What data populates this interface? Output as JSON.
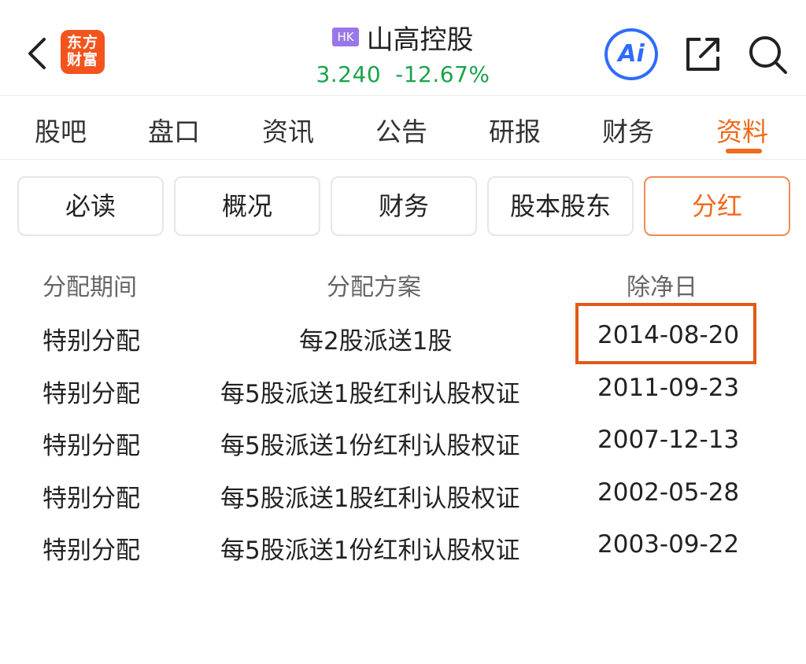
{
  "header": {
    "logo_line1": "东方",
    "logo_line2": "财富",
    "market_badge": "HK",
    "stock_name": "山高控股",
    "price": "3.240",
    "change_pct": "-12.67%",
    "ai_label": "Ai"
  },
  "tabs": [
    {
      "label": "股吧"
    },
    {
      "label": "盘口"
    },
    {
      "label": "资讯"
    },
    {
      "label": "公告"
    },
    {
      "label": "研报"
    },
    {
      "label": "财务"
    },
    {
      "label": "资料"
    }
  ],
  "subtabs": [
    {
      "label": "必读"
    },
    {
      "label": "概况"
    },
    {
      "label": "财务"
    },
    {
      "label": "股本股东"
    },
    {
      "label": "分红"
    }
  ],
  "table": {
    "headers": [
      "分配期间",
      "分配方案",
      "除净日"
    ],
    "rows": [
      {
        "period": "特别分配",
        "plan": "每2股派送1股",
        "ex_date": "2014-08-20"
      },
      {
        "period": "特别分配",
        "plan": "每5股派送1股红利认股权证",
        "ex_date": "2011-09-23"
      },
      {
        "period": "特别分配",
        "plan": "每5股派送1份红利认股权证",
        "ex_date": "2007-12-13"
      },
      {
        "period": "特别分配",
        "plan": "每5股派送1股红利认股权证",
        "ex_date": "2002-05-28"
      },
      {
        "period": "特别分配",
        "plan": "每5股派送1份红利认股权证",
        "ex_date": "2003-09-22"
      }
    ]
  },
  "colors": {
    "accent": "#f06a1b",
    "up_down_green": "#1aa34a",
    "ai_blue": "#2f6bff",
    "hk_badge": "#9a77e8",
    "highlight_box": "#e05a1a"
  },
  "icons": [
    "back-arrow-icon",
    "share-icon",
    "search-icon"
  ]
}
